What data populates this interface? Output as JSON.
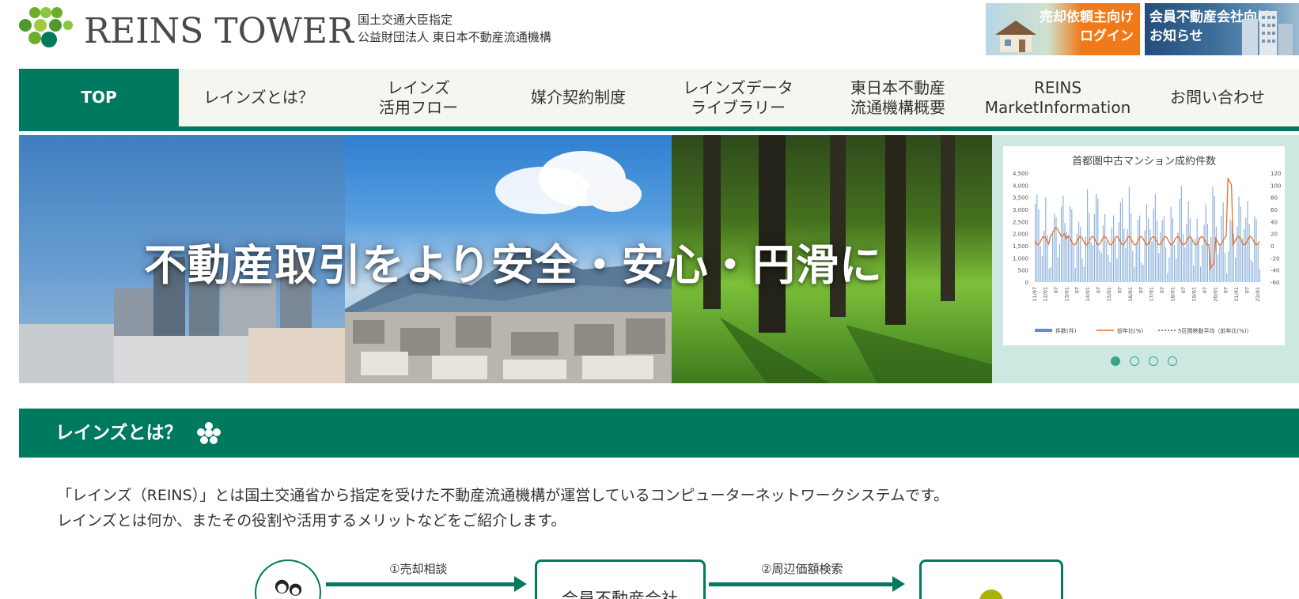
{
  "header": {
    "logo_text": "REINS TOWER",
    "org_line1": "国土交通大臣指定",
    "org_line2": "公益財団法人 東日本不動産流通機構",
    "seller_button": {
      "line1": "売却依頼主向け",
      "line2": "ログイン"
    },
    "member_button": {
      "line1": "会員不動産会社向け",
      "line2": "お知らせ"
    }
  },
  "nav": {
    "items": [
      {
        "label": "TOP",
        "active": true
      },
      {
        "label": "レインズとは？",
        "active": false
      },
      {
        "label": "レインズ\n活用フロー",
        "active": false
      },
      {
        "label": "媒介契約制度",
        "active": false
      },
      {
        "label": "レインズデータ\nライブラリー",
        "active": false
      },
      {
        "label": "東日本不動産\n流通機構概要",
        "active": false
      },
      {
        "label": "REINS\nMarketInformation",
        "active": false
      },
      {
        "label": "お問い合わせ",
        "active": false
      }
    ]
  },
  "hero": {
    "slogan": "不動産取引をより安全・安心・円滑に",
    "carousel": {
      "count": 4,
      "active_index": 0
    },
    "chart_title": "首都圏中古マンション成約件数",
    "chart_legend": [
      "件数(件)",
      "前年比(%)",
      "5区間移動平均（前年比(%)）"
    ],
    "chart_left_ticks": [
      "4,500",
      "4,000",
      "3,500",
      "3,000",
      "2,500",
      "2,000",
      "1,500",
      "1,000",
      "500",
      "0"
    ],
    "chart_right_ticks": [
      "120",
      "100",
      "80",
      "60",
      "40",
      "20",
      "0",
      "-20",
      "-40",
      "-60"
    ],
    "chart_x_ticks": [
      "11/07",
      "12/01",
      "07",
      "13/01",
      "07",
      "14/01",
      "07",
      "15/01",
      "07",
      "16/01",
      "07",
      "17/01",
      "07",
      "18/01",
      "07",
      "19/01",
      "07",
      "20/01",
      "07",
      "21/01",
      "07",
      "22/01"
    ]
  },
  "section": {
    "title": "レインズとは？",
    "intro_line1": "「レインズ（REINS）」とは国土交通省から指定を受けた不動産流通機構が運営しているコンピューターネットワークシステムです。",
    "intro_line2": "レインズとは何か、またその役割や活用するメリットなどをご紹介します。"
  },
  "flow": {
    "step1_label": "①売却相談",
    "box1_label": "会員不動産会社",
    "step2_label": "②周辺価額検索"
  },
  "colors": {
    "brand_green": "#007a5e",
    "nav_bg": "#f6f6f1",
    "seller_orange": "#f07a1a",
    "member_navy": "#2f5c8a",
    "chart_panel_bg": "#cde8e0"
  }
}
